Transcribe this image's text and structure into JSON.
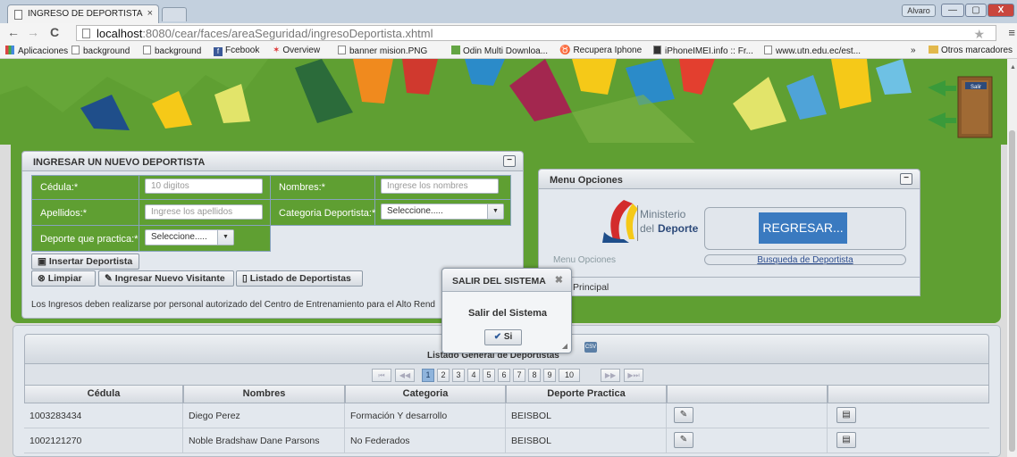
{
  "browser": {
    "tab_title": "INGRESO DE DEPORTISTA",
    "tab_close": "×",
    "user_badge": "Alvaro",
    "win_min": "—",
    "win_max": "▢",
    "win_close": "X",
    "url_host": "localhost",
    "url_path": ":8080/cear/faces/areaSeguridad/ingresoDeportista.xhtml",
    "back_icon": "←",
    "forward_icon": "→",
    "reload_icon": "C",
    "star_icon": "★",
    "menu_icon": "≡",
    "bookmarks": [
      {
        "label": "Aplicaciones",
        "icon": "apps-icon"
      },
      {
        "label": "background",
        "icon": "page-icon"
      },
      {
        "label": "background",
        "icon": "page-icon"
      },
      {
        "label": "Fcebook",
        "icon": "facebook-icon"
      },
      {
        "label": "Overview",
        "icon": "overview-icon"
      },
      {
        "label": "banner mision.PNG",
        "icon": "page-icon"
      },
      {
        "label": "Odin Multi Downloa...",
        "icon": "odin-icon"
      },
      {
        "label": "Recupera Iphone",
        "icon": "recupera-icon"
      },
      {
        "label": "iPhoneIMEI.info :: Fr...",
        "icon": "phone-icon"
      },
      {
        "label": "www.utn.edu.ec/est...",
        "icon": "page-icon"
      }
    ],
    "bookmarks_more": "»",
    "other_bookmarks": "Otros marcadores"
  },
  "header_door": {
    "label": "Salir"
  },
  "form": {
    "title": "INGRESAR UN NUEVO DEPORTISTA",
    "toggle": "−",
    "cedula_label": "Cédula:*",
    "cedula_placeholder": "10 digitos",
    "nombres_label": "Nombres:*",
    "nombres_placeholder": "Ingrese los nombres",
    "apellidos_label": "Apellidos:*",
    "apellidos_placeholder": "Ingrese los apellidos",
    "categoria_label": "Categoria Deportista:*",
    "categoria_value": "Seleccione.....",
    "deporte_label": "Deporte que practica:*",
    "deporte_value": "Seleccione.....",
    "insertar_btn": "Insertar Deportista",
    "limpiar_btn": "Limpiar",
    "nuevo_visitante_btn": "Ingresar Nuevo Visitante",
    "listado_btn": "Listado de Deportistas",
    "note": "Los Ingresos deben realizarse por personal autorizado del Centro de Entrenamiento para el Alto Rend"
  },
  "menu": {
    "title": "Menu Opciones",
    "toggle": "−",
    "logo_ministerio": "Ministerio",
    "logo_del": "del",
    "logo_deporte": "Deporte",
    "regresar": "REGRESAR...",
    "busqueda_link": "Busqueda de Deportista",
    "menu_label": "Menu Opciones",
    "principal": "Principal"
  },
  "dialog": {
    "title": "SALIR DEL SISTEMA",
    "close": "✖",
    "message": "Salir del Sistema",
    "confirm": "Si",
    "confirm_icon": "✔"
  },
  "listado": {
    "title": "Listado General de Deportistas",
    "csv_label": "CSV",
    "pager": {
      "first": "⏮",
      "prev": "◀◀",
      "pages": [
        "1",
        "2",
        "3",
        "4",
        "5",
        "6",
        "7",
        "8",
        "9",
        "10"
      ],
      "active": "1",
      "next": "▶▶",
      "last": "▶⏭"
    },
    "columns": [
      "Cédula",
      "Nombres",
      "Categoria",
      "Deporte Practica",
      "",
      ""
    ],
    "rows": [
      {
        "cedula": "1003283434",
        "nombres": "Diego Perez",
        "categoria": "Formación Y desarrollo",
        "deporte": "BEISBOL"
      },
      {
        "cedula": "1002121270",
        "nombres": "Noble Bradshaw Dane Parsons",
        "categoria": "No Federados",
        "deporte": "BEISBOL"
      }
    ]
  },
  "colors": {
    "green": "#5f9f32",
    "panel": "#e3e8ee",
    "regresar_blue": "#3a7ac0"
  }
}
